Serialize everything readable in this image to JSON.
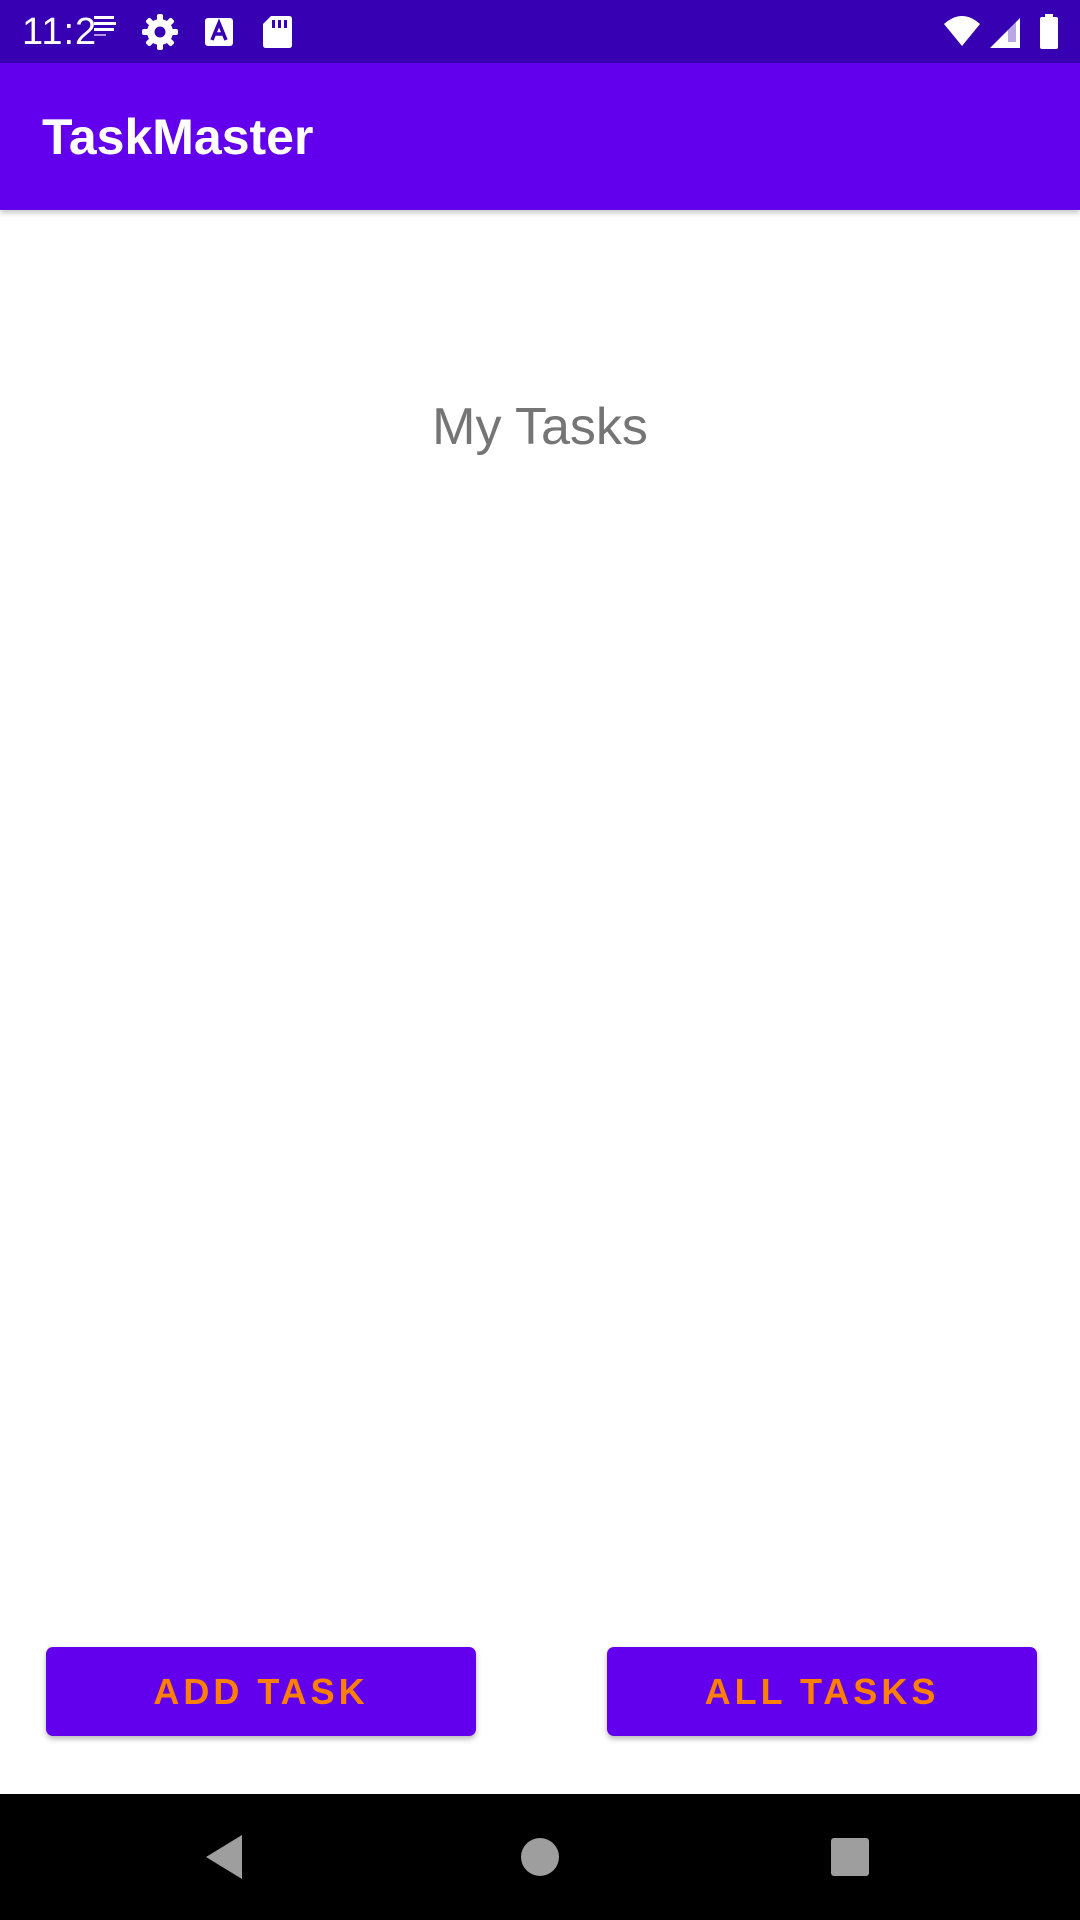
{
  "status_bar": {
    "time": "11:2",
    "icons": [
      "notification-badge-icon",
      "settings-icon",
      "text-a-icon",
      "sd-card-icon",
      "wifi-icon",
      "signal-icon",
      "battery-icon"
    ],
    "background": "#3700b3"
  },
  "app_bar": {
    "title": "TaskMaster",
    "background": "#6200ee"
  },
  "main": {
    "heading": "My Tasks",
    "heading_color": "#757575"
  },
  "buttons": {
    "add_task_label": "ADD TASK",
    "all_tasks_label": "ALL TASKS",
    "background": "#6200ee",
    "text_color": "#ff8000"
  },
  "nav_bar": {
    "icons": [
      "back-icon",
      "home-icon",
      "recents-icon"
    ],
    "background": "#000000"
  }
}
